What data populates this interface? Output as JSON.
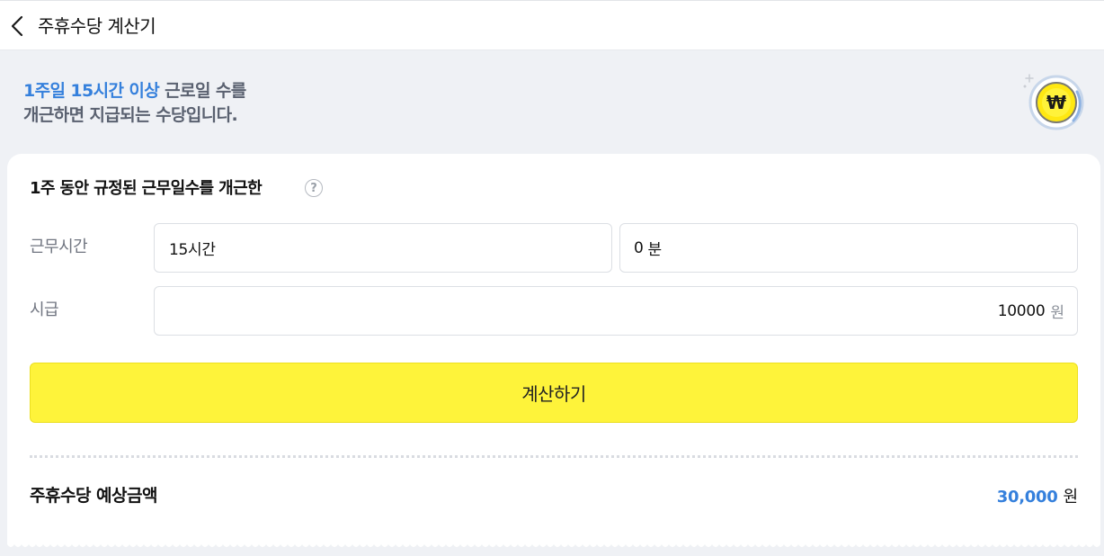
{
  "header": {
    "title": "주휴수당 계산기",
    "back_icon": "chevron-left-icon"
  },
  "hero": {
    "line1_highlight": "1주일 15시간 이상",
    "line1_rest": " 근로일 수를",
    "line2": "개근하면 지급되는 수당입니다.",
    "coin_symbol": "₩",
    "coin_icon": "won-coin-icon"
  },
  "form": {
    "title": "1주 동안 규정된 근무일수를 개근한",
    "help_symbol": "?",
    "work_time_label": "근무시간",
    "hours_value": "15시간",
    "minutes_value": "0",
    "minutes_unit": "분",
    "wage_label": "시급",
    "wage_value": "10000",
    "wage_unit": "원",
    "calc_button": "계산하기"
  },
  "result": {
    "label": "주휴수당 예상금액",
    "amount": "30,000",
    "unit": "원"
  },
  "colors": {
    "accent_blue": "#3580dc",
    "button_yellow": "#fef33a",
    "hero_bg": "#eff1f5",
    "coin_yellow": "#ffe812"
  }
}
